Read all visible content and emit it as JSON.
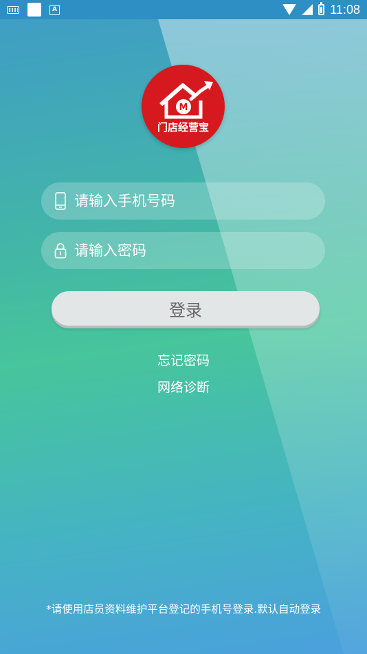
{
  "status_bar": {
    "time": "11:08",
    "icons": [
      "keyboard-icon",
      "app-icon",
      "text-a-icon",
      "wifi-icon",
      "cell-signal-icon",
      "battery-icon"
    ]
  },
  "logo": {
    "text": "门店经营宝",
    "color": "#d6191e"
  },
  "form": {
    "phone_placeholder": "请输入手机号码",
    "password_placeholder": "请输入密码",
    "login_label": "登录"
  },
  "links": {
    "forgot_password": "忘记密码",
    "network_diagnosis": "网络诊断"
  },
  "notice": "*请使用店员资料维护平台登记的手机号登录.默认自动登录"
}
